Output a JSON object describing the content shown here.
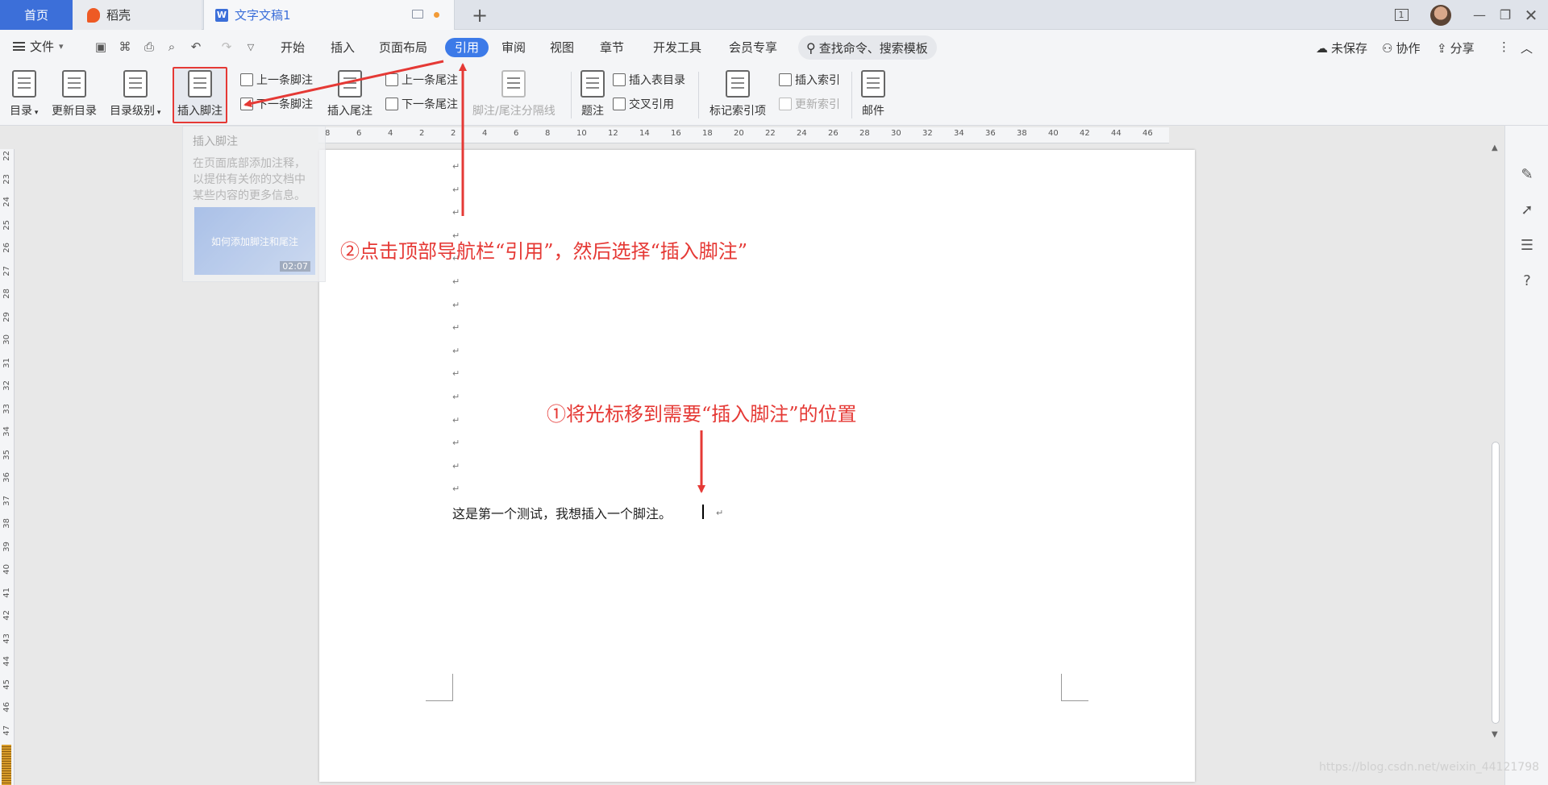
{
  "tabs": {
    "home": "首页",
    "daoke": "稻壳",
    "doc": "文字文稿1",
    "badge": "1"
  },
  "menu": {
    "file": "文件",
    "items": [
      "开始",
      "插入",
      "页面布局",
      "引用",
      "审阅",
      "视图",
      "章节",
      "开发工具",
      "会员专享"
    ],
    "active": "引用",
    "search_placeholder": "查找命令、搜索模板",
    "unsaved": "未保存",
    "collab": "协作",
    "share": "分享"
  },
  "ribbon": {
    "toc": "目录",
    "update_toc": "更新目录",
    "toc_level": "目录级别",
    "insert_footnote": "插入脚注",
    "prev_footnote": "上一条脚注",
    "next_footnote": "下一条脚注",
    "insert_endnote": "插入尾注",
    "prev_endnote": "上一条尾注",
    "next_endnote": "下一条尾注",
    "separator": "脚注/尾注分隔线",
    "caption": "题注",
    "insert_table_of_figures": "插入表目录",
    "cross_reference": "交叉引用",
    "mark_entry": "标记索引项",
    "insert_index": "插入索引",
    "update_index": "更新索引",
    "mail": "邮件"
  },
  "tooltip": {
    "title": "插入脚注",
    "body": "在页面底部添加注释，以提供有关你的文档中某些内容的更多信息。",
    "video_title": "如何添加脚注和尾注",
    "video_time": "02:07"
  },
  "ruler": {
    "h_ticks": [
      "8",
      "6",
      "4",
      "2",
      "2",
      "4",
      "6",
      "8",
      "10",
      "12",
      "14",
      "16",
      "18",
      "20",
      "22",
      "24",
      "26",
      "28",
      "30",
      "32",
      "34",
      "36",
      "38",
      "40",
      "42",
      "44",
      "46"
    ],
    "v_ticks": [
      "22",
      "23",
      "24",
      "25",
      "26",
      "27",
      "28",
      "29",
      "30",
      "31",
      "32",
      "33",
      "34",
      "35",
      "36",
      "37",
      "38",
      "39",
      "40",
      "41",
      "42",
      "43",
      "44",
      "45",
      "46",
      "47"
    ]
  },
  "document": {
    "paragraph_mark": "↵",
    "text": "这是第一个测试，我想插入一个脚注。"
  },
  "annotations": {
    "step2": "②点击顶部导航栏“引用”，然后选择“插入脚注”",
    "step1": "①将光标移到需要“插入脚注”的位置",
    "color": "#e53935"
  },
  "watermark": "https://blog.csdn.net/weixin_44121798"
}
